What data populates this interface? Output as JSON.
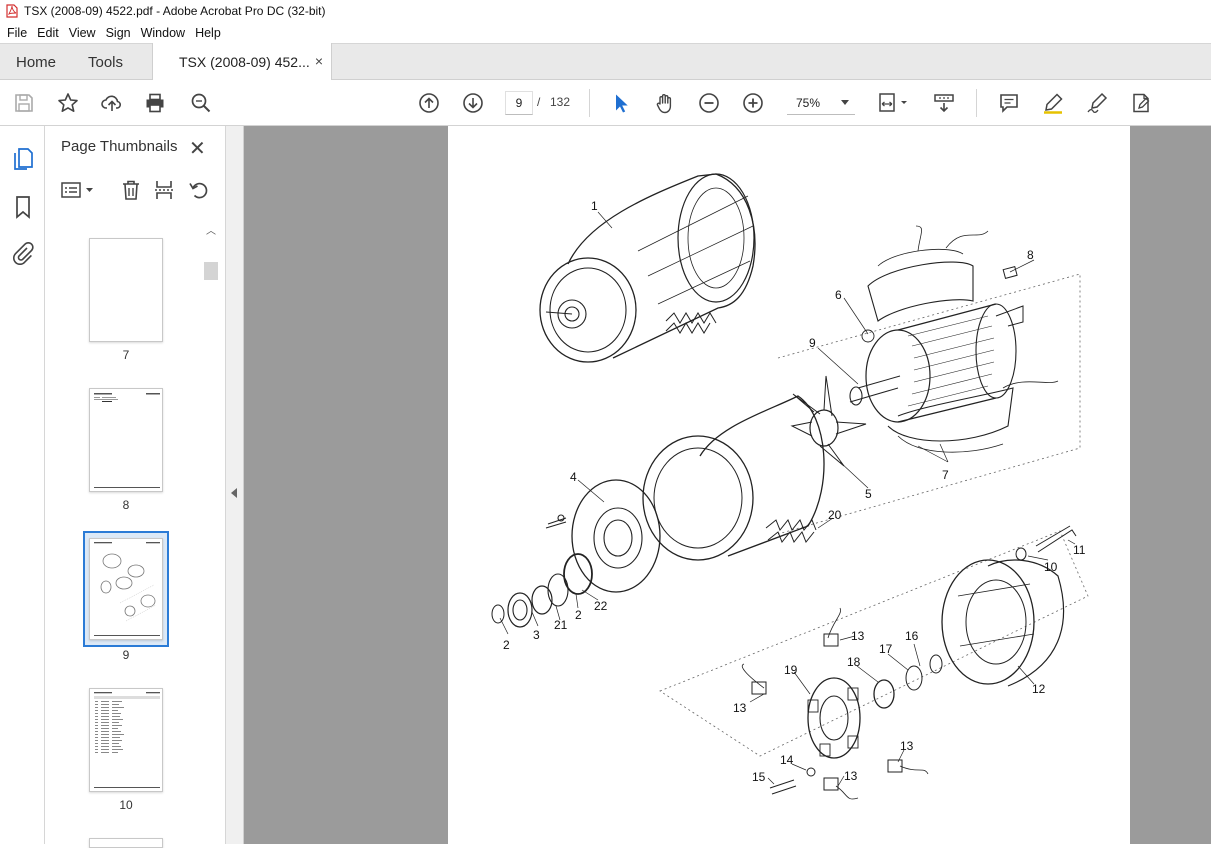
{
  "window": {
    "title": "TSX (2008-09) 4522.pdf - Adobe Acrobat Pro DC (32-bit)"
  },
  "menu": [
    "File",
    "Edit",
    "View",
    "Sign",
    "Window",
    "Help"
  ],
  "tabs": {
    "home": "Home",
    "tools": "Tools",
    "document": "TSX (2008-09) 452...",
    "close_symbol": "×"
  },
  "toolbar": {
    "current_page": "9",
    "page_separator": "/",
    "total_pages": "132",
    "zoom": "75%"
  },
  "thumbnail_panel": {
    "title": "Page Thumbnails",
    "close_symbol": "✕",
    "pages": [
      {
        "label": "7",
        "selected": false
      },
      {
        "label": "8",
        "selected": false
      },
      {
        "label": "9",
        "selected": true
      },
      {
        "label": "10",
        "selected": false
      }
    ]
  },
  "diagram": {
    "callouts": [
      "1",
      "8",
      "6",
      "9",
      "7",
      "5",
      "4",
      "20",
      "11",
      "10",
      "2",
      "3",
      "21",
      "2",
      "22",
      "13",
      "16",
      "19",
      "18",
      "17",
      "12",
      "13",
      "13",
      "14",
      "15",
      "13"
    ]
  },
  "icons": {
    "save": "save-icon",
    "bookmark_star": "star-icon",
    "upload": "upload-icon",
    "print": "print-icon",
    "find": "zoom-search-icon",
    "prev_page": "arrow-up-circle-icon",
    "next_page": "arrow-down-circle-icon",
    "select": "cursor-icon",
    "hand": "hand-icon",
    "zoom_out": "zoom-out-icon",
    "zoom_in": "zoom-in-icon",
    "fit": "fit-page-icon",
    "scroll_mode": "scroll-mode-icon",
    "comment": "comment-icon",
    "highlight": "highlight-pen-icon",
    "sign": "sign-pen-icon",
    "more_tools": "edit-pdf-icon"
  }
}
